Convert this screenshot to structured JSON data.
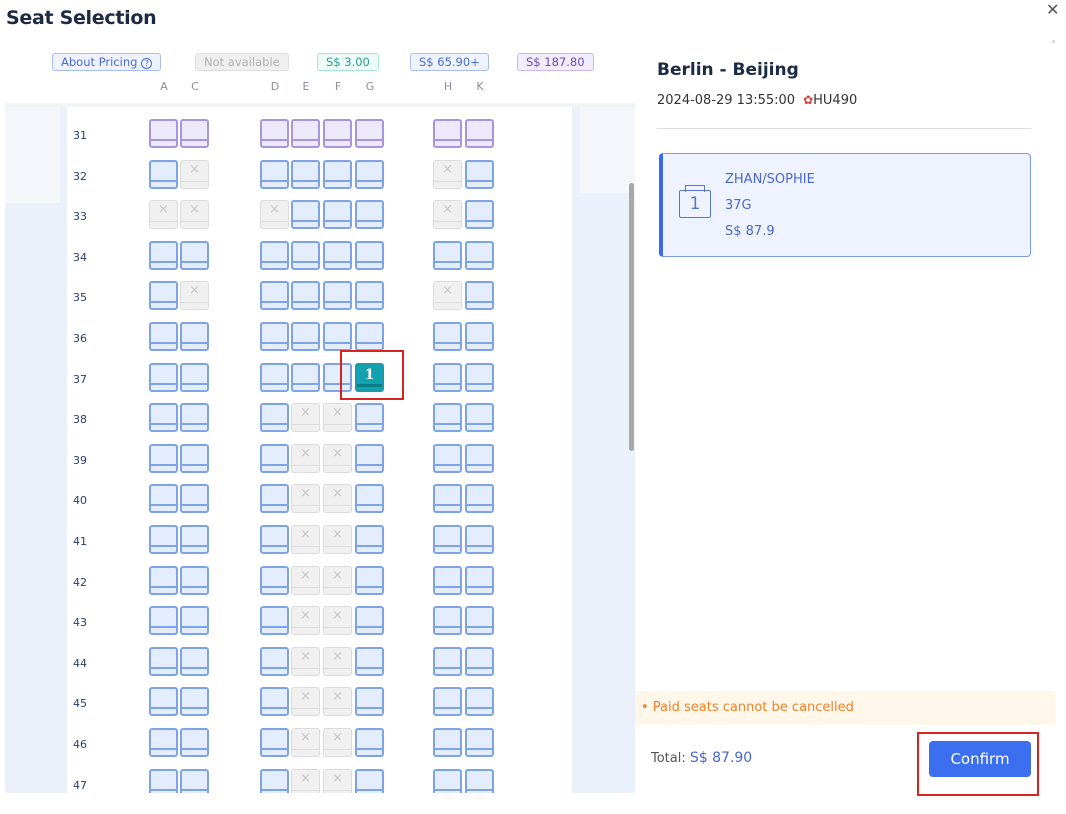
{
  "header": {
    "title": "Seat Selection",
    "close_icon": "close-icon"
  },
  "legend": {
    "about_pricing": "About Pricing",
    "help_glyph": "?",
    "not_available": "Not available",
    "price_tier_1": "S$ 3.00",
    "price_tier_2": "S$ 65.90+",
    "price_tier_3": "S$ 187.80"
  },
  "columns": [
    "A",
    "C",
    "D",
    "E",
    "F",
    "G",
    "H",
    "K"
  ],
  "seatmap": {
    "unavailable_glyph": "×",
    "rows": [
      {
        "num": "31",
        "seats": [
          "premium",
          "premium",
          "premium",
          "premium",
          "premium",
          "premium",
          "premium",
          "premium"
        ]
      },
      {
        "num": "32",
        "seats": [
          "avail",
          "na",
          "avail",
          "avail",
          "avail",
          "avail",
          "na",
          "avail"
        ]
      },
      {
        "num": "33",
        "seats": [
          "na",
          "na",
          "na",
          "avail",
          "avail",
          "avail",
          "na",
          "avail"
        ]
      },
      {
        "num": "34",
        "seats": [
          "avail",
          "avail",
          "avail",
          "avail",
          "avail",
          "avail",
          "avail",
          "avail"
        ]
      },
      {
        "num": "35",
        "seats": [
          "avail",
          "na",
          "avail",
          "avail",
          "avail",
          "avail",
          "na",
          "avail"
        ]
      },
      {
        "num": "36",
        "seats": [
          "avail",
          "avail",
          "avail",
          "avail",
          "avail",
          "avail",
          "avail",
          "avail"
        ]
      },
      {
        "num": "37",
        "seats": [
          "avail",
          "avail",
          "avail",
          "avail",
          "avail",
          "selected",
          "avail",
          "avail"
        ]
      },
      {
        "num": "38",
        "seats": [
          "avail",
          "avail",
          "avail",
          "na",
          "na",
          "avail",
          "avail",
          "avail"
        ]
      },
      {
        "num": "39",
        "seats": [
          "avail",
          "avail",
          "avail",
          "na",
          "na",
          "avail",
          "avail",
          "avail"
        ]
      },
      {
        "num": "40",
        "seats": [
          "avail",
          "avail",
          "avail",
          "na",
          "na",
          "avail",
          "avail",
          "avail"
        ]
      },
      {
        "num": "41",
        "seats": [
          "avail",
          "avail",
          "avail",
          "na",
          "na",
          "avail",
          "avail",
          "avail"
        ]
      },
      {
        "num": "42",
        "seats": [
          "avail",
          "avail",
          "avail",
          "na",
          "na",
          "avail",
          "avail",
          "avail"
        ]
      },
      {
        "num": "43",
        "seats": [
          "avail",
          "avail",
          "avail",
          "na",
          "na",
          "avail",
          "avail",
          "avail"
        ]
      },
      {
        "num": "44",
        "seats": [
          "avail",
          "avail",
          "avail",
          "na",
          "na",
          "avail",
          "avail",
          "avail"
        ]
      },
      {
        "num": "45",
        "seats": [
          "avail",
          "avail",
          "avail",
          "na",
          "na",
          "avail",
          "avail",
          "avail"
        ]
      },
      {
        "num": "46",
        "seats": [
          "avail",
          "avail",
          "avail",
          "na",
          "na",
          "avail",
          "avail",
          "avail"
        ]
      },
      {
        "num": "47",
        "seats": [
          "avail",
          "avail",
          "avail",
          "na",
          "na",
          "avail",
          "avail",
          "avail"
        ]
      }
    ],
    "selected_label": "1"
  },
  "flight": {
    "route": "Berlin - Beijing",
    "datetime": "2024-08-29 13:55:00",
    "airline_icon": "airline-logo-icon",
    "flight_no": "HU490"
  },
  "passenger": {
    "index": "1",
    "name": "ZHAN/SOPHIE",
    "seat": "37G",
    "price": "S$ 87.9"
  },
  "footer": {
    "notice": "• Paid seats cannot be cancelled",
    "total_label": "Total:",
    "total_amount": "S$ 87.90",
    "confirm_label": "Confirm"
  },
  "colors": {
    "accent": "#3b6ff0",
    "selected_seat": "#12a3b1",
    "notice_text": "#f0822a",
    "highlight_box": "#d9231f"
  }
}
